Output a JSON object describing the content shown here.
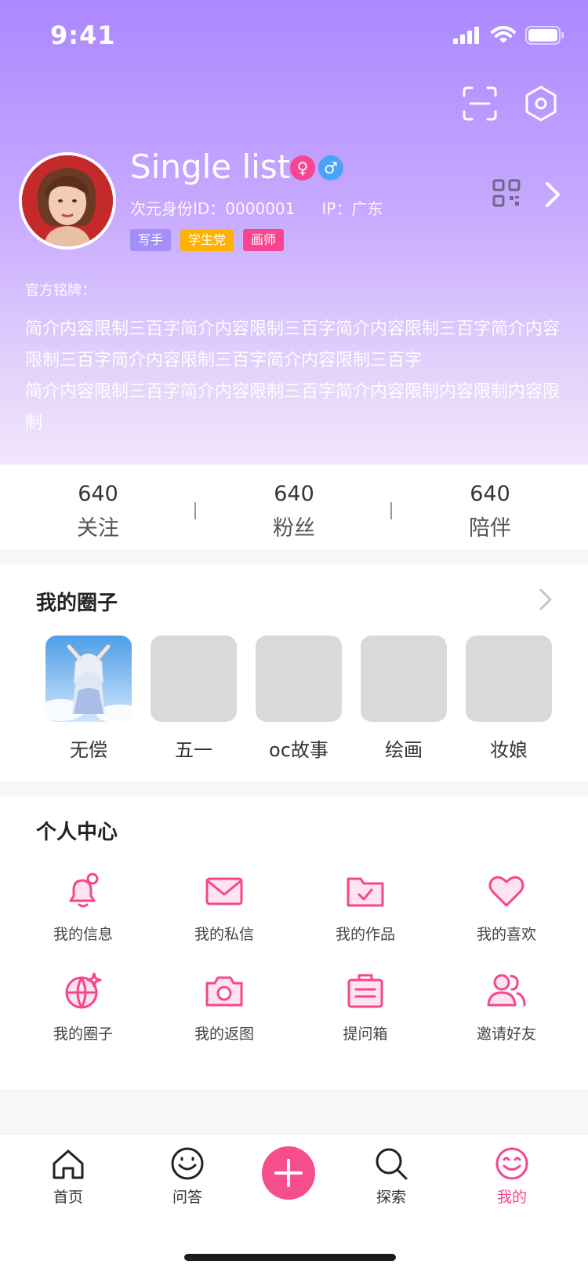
{
  "status_bar": {
    "time": "9:41"
  },
  "profile": {
    "name": "Single list",
    "id_text": "次元身份ID：0000001",
    "ip_text": "IP：广东",
    "tags": [
      {
        "label": "写手",
        "color": "#a48ef7"
      },
      {
        "label": "学生党",
        "color": "#ffb300"
      },
      {
        "label": "画师",
        "color": "#f6468f"
      }
    ],
    "badge_label": "官方铭牌：",
    "bio": "简介内容限制三百字简介内容限制三百字简介内容限制三百字简介内容限制三百字简介内容限制三百字简介内容限制三百字\n简介内容限制三百字简介内容限制三百字简介内容限制内容限制内容限制"
  },
  "stats": [
    {
      "value": "640",
      "label": "关注"
    },
    {
      "value": "640",
      "label": "粉丝"
    },
    {
      "value": "640",
      "label": "陪伴"
    }
  ],
  "circles": {
    "title": "我的圈子",
    "items": [
      {
        "label": "无偿"
      },
      {
        "label": "五一"
      },
      {
        "label": "oc故事"
      },
      {
        "label": "绘画"
      },
      {
        "label": "妆娘"
      }
    ]
  },
  "personal_center": {
    "title": "个人中心",
    "items": [
      {
        "label": "我的信息",
        "icon": "bell-icon"
      },
      {
        "label": "我的私信",
        "icon": "mail-icon"
      },
      {
        "label": "我的作品",
        "icon": "folder-check-icon"
      },
      {
        "label": "我的喜欢",
        "icon": "heart-icon"
      },
      {
        "label": "我的圈子",
        "icon": "globe-sparkle-icon"
      },
      {
        "label": "我的返图",
        "icon": "camera-icon"
      },
      {
        "label": "提问箱",
        "icon": "clipboard-icon"
      },
      {
        "label": "邀请好友",
        "icon": "users-icon"
      }
    ]
  },
  "tabbar": {
    "items": [
      {
        "label": "首页",
        "icon": "home-icon"
      },
      {
        "label": "问答",
        "icon": "smile-icon"
      },
      {
        "label": "探索",
        "icon": "search-icon"
      },
      {
        "label": "我的",
        "icon": "me-face-icon"
      }
    ]
  },
  "colors": {
    "accent_pink": "#f6468f",
    "header_purple": "#ab88ff"
  }
}
